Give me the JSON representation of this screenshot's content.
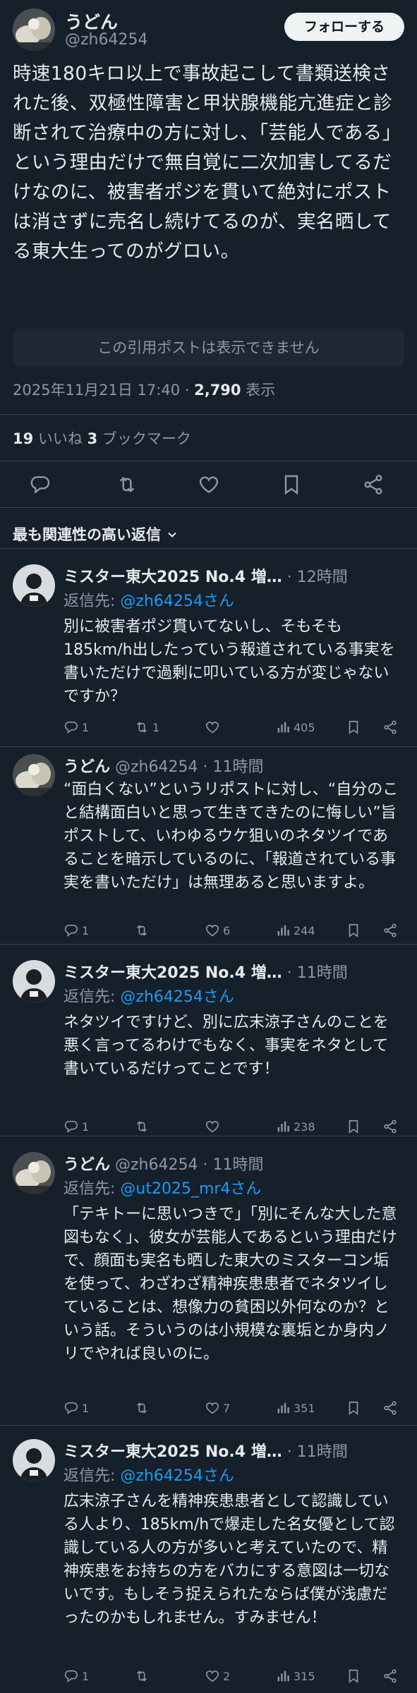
{
  "main": {
    "name": "うどん",
    "handle": "@zh64254",
    "follow_label": "フォローする",
    "text": "時速180キロ以上で事故起こして書類送検された後、双極性障害と甲状腺機能亢進症と診断されて治療中の方に対し、「芸能人である」という理由だけで無自覚に二次加害してるだけなのに、被害者ポジを貫いて絶対にポストは消さずに売名し続けてるのが、実名晒してる東大生ってのがグロい。",
    "quote_unavailable": "この引用ポストは表示できません",
    "timestamp": "2025年11月21日 17:40 · ",
    "views_count": "2,790",
    "views_label": " 表示",
    "likes_count": "19",
    "likes_label": " いいね  ",
    "bookmarks_count": "3",
    "bookmarks_label": " ブックマーク"
  },
  "sort_label": "最も関連性の高い返信",
  "replies": [
    {
      "name": "ミスター東大2025 No.4 増…",
      "meta": " · 12時間",
      "replyto_prefix": "返信先: ",
      "replyto": "@zh64254さん",
      "text": "別に被害者ポジ貫いてないし、そもそも185km/h出したっていう報道されている事実を書いただけで過剰に叩いている方が変じゃないですか？",
      "reply_count": "1",
      "repost_count": "1",
      "like_count": "",
      "view_count": "405"
    },
    {
      "name": "うどん",
      "meta": " @zh64254 · 11時間",
      "replyto_prefix": "",
      "replyto": "",
      "text": "“面白くない”というリポストに対し、“自分のこと結構面白いと思って生きてきたのに悔しい”旨ポストして、いわゆるウケ狙いのネタツイであることを暗示しているのに、「報道されている事実を書いただけ」は無理あると思いますよ。",
      "reply_count": "1",
      "repost_count": "",
      "like_count": "6",
      "view_count": "244"
    },
    {
      "name": "ミスター東大2025 No.4 増…",
      "meta": " · 11時間",
      "replyto_prefix": "返信先: ",
      "replyto": "@zh64254さん",
      "text": "ネタツイですけど、別に広末涼子さんのことを悪く言ってるわけでもなく、事実をネタとして書いているだけってことです！",
      "reply_count": "1",
      "repost_count": "",
      "like_count": "",
      "view_count": "238"
    },
    {
      "name": "うどん",
      "meta": " @zh64254 · 11時間",
      "replyto_prefix": "返信先: ",
      "replyto": "@ut2025_mr4さん",
      "text": "「テキトーに思いつきで」「別にそんな大した意図もなく」、彼女が芸能人であるという理由だけで、顔面も実名も晒した東大のミスターコン垢を使って、わざわざ精神疾患患者でネタツイしていることは、想像力の貧困以外何なのか？という話。そういうのは小規模な裏垢とか身内ノリでやれば良いのに。",
      "reply_count": "1",
      "repost_count": "",
      "like_count": "7",
      "view_count": "351"
    },
    {
      "name": "ミスター東大2025 No.4 増…",
      "meta": " · 11時間",
      "replyto_prefix": "返信先: ",
      "replyto": "@zh64254さん",
      "text": "広末涼子さんを精神疾患患者として認識している人より、185km/hで爆走した名女優として認識している人の方が多いと考えていたので、精神疾患をお持ちの方をバカにする意図は一切ないです。もしそう捉えられたならば僕が浅慮だったのかもしれません。すみません！",
      "reply_count": "1",
      "repost_count": "",
      "like_count": "2",
      "view_count": "315"
    }
  ],
  "colors": {
    "background": "#15202b",
    "text": "#e7e9ea",
    "muted": "#8b98a5",
    "link": "#1d9bf0",
    "divider": "#38444d"
  },
  "icons": [
    "reply-icon",
    "repost-icon",
    "like-icon",
    "bookmark-icon",
    "share-icon",
    "views-icon",
    "chevron-down-icon"
  ]
}
